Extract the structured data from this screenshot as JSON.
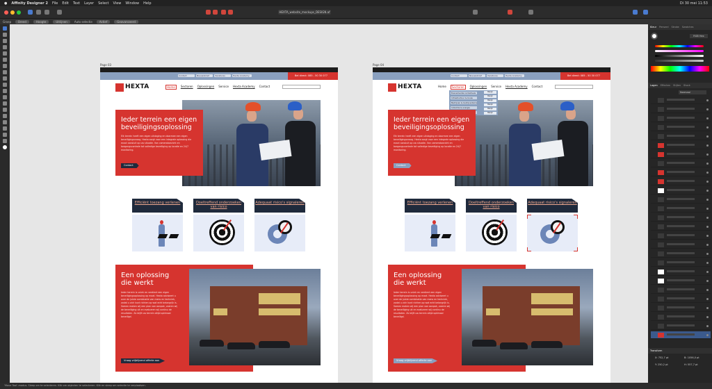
{
  "menubar": {
    "app": "Affinity Designer 2",
    "items": [
      "File",
      "Edit",
      "Text",
      "Layer",
      "Select",
      "View",
      "Window",
      "Help"
    ],
    "clock": "Di 30 mei  11:53"
  },
  "toolbar": {
    "document_title": "HEXTA_website_mockups_DESIGN.af"
  },
  "context_bar": {
    "label1": "Groep",
    "label2": "Breed",
    "label3": "Hoogte",
    "label4": "Uitlijnen",
    "label5": "Auto selectie",
    "value": "Actief",
    "label6": "Geavanceerd"
  },
  "artboards": [
    {
      "label": "Page 03",
      "show_dropdown": false
    },
    {
      "label": "Page 04",
      "show_dropdown": true
    }
  ],
  "site": {
    "logo_text": "HEXTA",
    "top_links": [
      "Contact",
      "Nieuwsbrief",
      "Vacatures",
      "Hexta Academy"
    ],
    "phone": "Bel direct: 085 - 50 30 077",
    "nav": [
      "Home",
      "Sectoren",
      "Oplossingen",
      "Service",
      "Hexta Academy",
      "Contact"
    ],
    "dropdown_items": [
      "Evenementen & festivals",
      "Infrastructuur & bouw",
      "Bedrijven & bedrijventerreinen",
      "Industrie & energie",
      "Overheid"
    ],
    "dropdown_buttons": [
      "Bekijk",
      "Bekijk",
      "Bekijk",
      "Bekijk",
      "Bekijk",
      "Bekijk"
    ],
    "hero": {
      "title": "Ieder terrein een eigen beveiligingsoplossing",
      "body": "Elk terrein heeft een eigen uitdaging en daarmee een eigen beveiligingsvraag. Hexta zorgt voor een integrale oplossing die exact aansluit op uw situatie. Van cameratoezicht en toegangscontrole tot volledige beveiliging op locatie en 24/7 monitoring.",
      "button": "Contact"
    },
    "features": [
      {
        "title": "Efficiënt toezang verlenen"
      },
      {
        "title": "Doeltreffend onderzoeken van risico"
      },
      {
        "title": "Adequaat risico's signaleren"
      }
    ],
    "solution": {
      "title": "Een oplossing die werkt",
      "body": "Ieder terrein is uniek en verdient een eigen beveiligingsoplossing op maat. Hexta adviseert u over de juiste combinatie van mens en techniek, zodat u zich kunt richten op wat echt belangrijk is. Samen maken wij een plan van aanpak, voeren wij de beveiliging uit en evalueren wij continu de resultaten. Zo blijft uw terrein altijd optimaal beveiligd.",
      "button": "Vraag vrijblijvend offerte aan"
    }
  },
  "panel": {
    "tabs": [
      "Kleur",
      "Penseel",
      "Stroke",
      "Swatches"
    ],
    "mode": "RGB Hex",
    "layer_tabs": [
      "Lagen",
      "Effecten",
      "Stijlen",
      "Stock"
    ],
    "blend": "Normaal",
    "transform_tab": "Transform",
    "transform_values": [
      "X: 752,7 pt",
      "Y: 250,2 pt",
      "B: 1056,0 pt",
      "H: 557,7 pt"
    ]
  },
  "statusbar": {
    "text": "'Move Tool'-modus. Sleep om te selecteren. Klik om objecten te selecteren. Klik en sleep om selectie te verplaatsen."
  }
}
